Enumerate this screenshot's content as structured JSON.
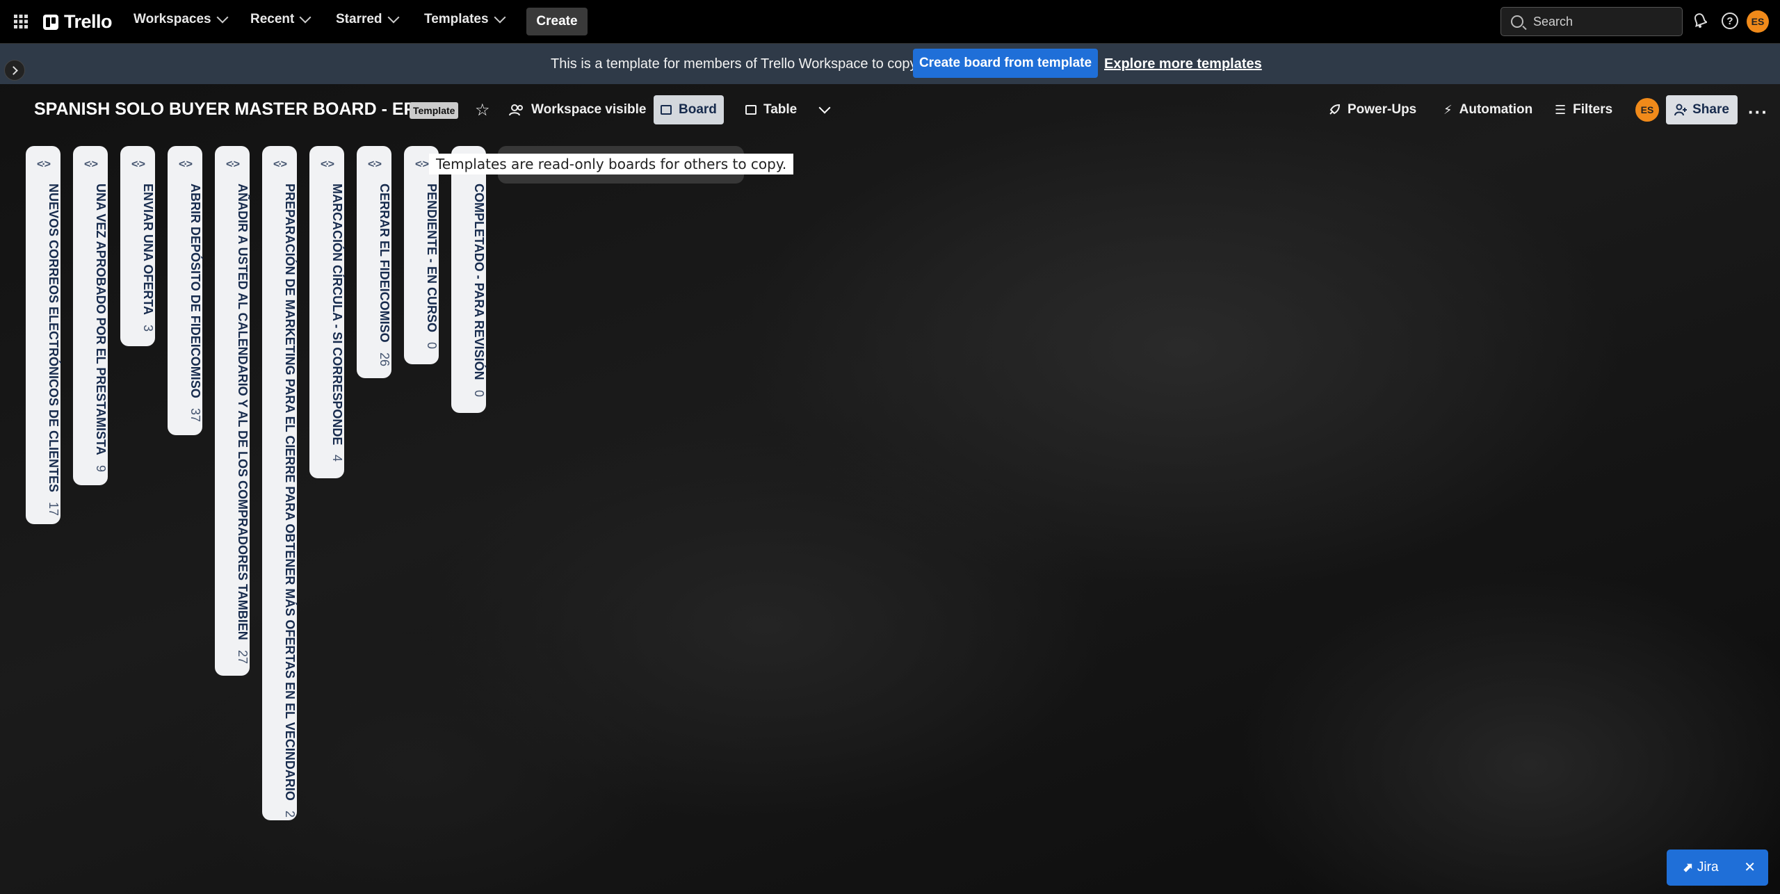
{
  "nav": {
    "logo": "Trello",
    "workspaces": "Workspaces",
    "recent": "Recent",
    "starred": "Starred",
    "templates": "Templates",
    "create": "Create",
    "search_placeholder": "Search",
    "avatar_initials": "ES"
  },
  "banner": {
    "text": "This is a template for members of Trello Workspace to copy.",
    "create_button": "Create board from template",
    "explore_link": "Explore more templates"
  },
  "board": {
    "title": "SPANISH SOLO BUYER MASTER BOARD - EPIC",
    "template_badge": "Template",
    "visibility": "Workspace visible",
    "view_board": "Board",
    "view_table": "Table",
    "power_ups": "Power-Ups",
    "automation": "Automation",
    "filters": "Filters",
    "share": "Share",
    "member_initials": "ES"
  },
  "lists": [
    {
      "name": "NUEVOS CORREOS ELECTRÓNICOS DE CLIENTES",
      "count": "17"
    },
    {
      "name": "UNA VEZ APROBADO POR EL PRESTAMISTA",
      "count": "9"
    },
    {
      "name": "ENVIAR UNA OFERTA",
      "count": "3"
    },
    {
      "name": "ABRIR DEPÓSITO DE FIDEICOMISO",
      "count": "37"
    },
    {
      "name": "AÑADIR A USTED AL CALENDARIO Y AL DE LOS COMPRADORES TAMBIEN",
      "count": "27"
    },
    {
      "name": "PREPARACIÓN DE MARKETING PARA EL CIERRE PARA OBTENER MÁS OFERTAS EN EL VECINDARIO",
      "count": "2"
    },
    {
      "name": "MARCACIÓN CÍRCULA - SI CORRESPONDE",
      "count": "4"
    },
    {
      "name": "CERRAR EL FIDEICOMISO",
      "count": "26"
    },
    {
      "name": "PENDIENTE - EN CURSO",
      "count": "0"
    },
    {
      "name": "COMPLETADO - PARA REVISIÓN",
      "count": "0"
    }
  ],
  "tooltip": "Templates are read-only boards for others to copy.",
  "jira": {
    "label": "Jira",
    "icon": "jira-icon",
    "close_icon": "close-icon"
  },
  "colors": {
    "accent": "#1f6fd8",
    "banner": "#2f3a48",
    "avatar": "#f08a1a"
  }
}
